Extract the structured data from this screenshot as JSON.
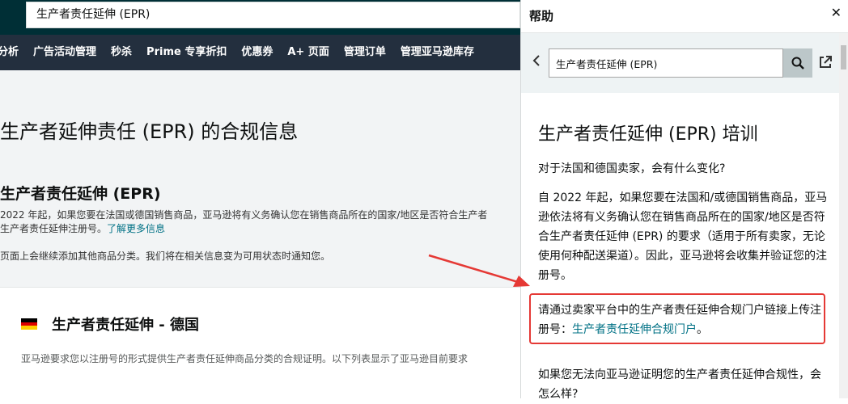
{
  "seller": {
    "search_value": "生产者责任延伸 (EPR)",
    "nav": [
      "分析",
      "广告活动管理",
      "秒杀",
      "Prime 专享折扣",
      "优惠券",
      "A+ 页面",
      "管理订单",
      "管理亚马逊库存"
    ],
    "page_title": "生产者延伸责任 (EPR) 的合规信息",
    "section_title": "生产者责任延伸 (EPR)",
    "para1_line1": "2022 年起，如果您要在法国或德国销售商品，亚马逊将有义务确认您在销售商品所在的国家/地区是否符合生产者",
    "para1_line2": "生产者责任延伸注册号。",
    "learn_more": "了解更多信息",
    "para2": "页面上会继续添加其他商品分类。我们将在相关信息变为可用状态时通知您。",
    "de_title": "生产者责任延伸 - 德国",
    "de_desc": "亚马逊要求您以注册号的形式提供生产者责任延伸商品分类的合规证明。以下列表显示了亚马逊目前要求"
  },
  "help": {
    "title": "帮助",
    "close": "✕",
    "search_value": "生产者责任延伸 (EPR)",
    "article_title": "生产者责任延伸 (EPR) 培训",
    "q1": "对于法国和德国卖家，会有什么变化?",
    "p1": "自 2022 年起，如果您要在法国和/或德国销售商品，亚马逊依法将有义务确认您在销售商品所在的国家/地区是否符合生产者责任延伸 (EPR) 的要求（适用于所有卖家，无论使用何种配送渠道）。因此，亚马逊将会收集并验证您的注册号。",
    "p2_text": "请通过卖家平台中的生产者责任延伸合规门户链接上传注册号：",
    "p2_link": "生产者责任延伸合规门户",
    "p2_end": "。",
    "q2": "如果您无法向亚马逊证明您的生产者责任延伸合规性，会怎么样?"
  },
  "colors": {
    "topbar": "#002f36",
    "navbar": "#232f3e",
    "link": "#007185",
    "highlight_box": "#e53935",
    "arrow": "#e53935"
  }
}
